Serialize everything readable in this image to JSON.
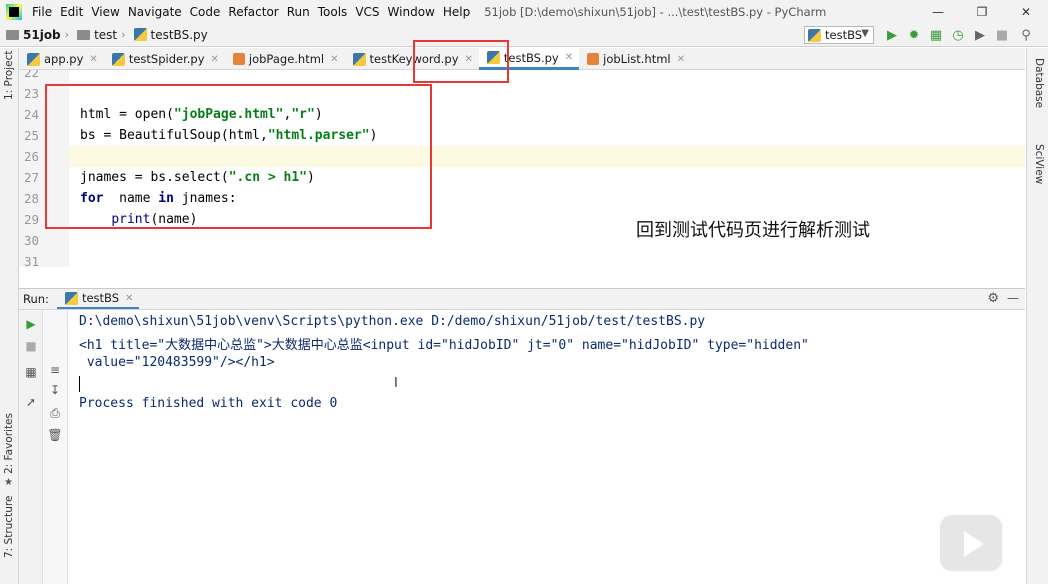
{
  "menu": {
    "items": [
      "File",
      "Edit",
      "View",
      "Navigate",
      "Code",
      "Refactor",
      "Run",
      "Tools",
      "VCS",
      "Window",
      "Help"
    ],
    "window_title": "51job [D:\\demo\\shixun\\51job] - ...\\test\\testBS.py - PyCharm"
  },
  "navbar": {
    "crumbs": [
      "51job",
      "test",
      "testBS.py"
    ],
    "run_config": "testBS"
  },
  "tabs": [
    {
      "label": "app.py",
      "icon": "python-file-icon"
    },
    {
      "label": "testSpider.py",
      "icon": "python-file-icon"
    },
    {
      "label": "jobPage.html",
      "icon": "html-file-icon"
    },
    {
      "label": "testKeyword.py",
      "icon": "python-file-icon"
    },
    {
      "label": "testBS.py",
      "icon": "python-file-icon",
      "active": true
    },
    {
      "label": "jobList.html",
      "icon": "html-file-icon"
    }
  ],
  "left_strip": {
    "project": "1: Project",
    "favorites": "2: Favorites",
    "structure": "7: Structure"
  },
  "right_strip": {
    "database": "Database",
    "sciview": "SciView"
  },
  "editor": {
    "line_numbers": [
      "22",
      "23",
      "24",
      "25",
      "26",
      "27",
      "28",
      "29",
      "30",
      "31"
    ],
    "lines": {
      "l24_a": "html = open(",
      "l24_s1": "\"jobPage.html\"",
      "l24_c": ",",
      "l24_s2": "\"r\"",
      "l24_e": ")",
      "l25_a": "bs = BeautifulSoup(html,",
      "l25_s": "\"html.parser\"",
      "l25_e": ")",
      "l27_a": "jnames = bs.select(",
      "l27_s": "\".cn > h1\"",
      "l27_e": ")",
      "l28_kw1": "for",
      "l28_mid": "  name ",
      "l28_kw2": "in",
      "l28_e": " jnames:",
      "l29_indent": "    ",
      "l29_fn": "print",
      "l29_e": "(name)"
    }
  },
  "overlay_caption": "回到测试代码页进行解析测试",
  "run_panel": {
    "title": "Run:",
    "tab": "testBS",
    "console": {
      "line1": "D:\\demo\\shixun\\51job\\venv\\Scripts\\python.exe D:/demo/shixun/51job/test/testBS.py",
      "line2": "<h1 title=\"大数据中心总监\">大数据中心总监<input id=\"hidJobID\" jt=\"0\" name=\"hidJobID\" type=\"hidden\"",
      "line3": " value=\"120483599\"/></h1>",
      "line5": "Process finished with exit code 0"
    }
  }
}
